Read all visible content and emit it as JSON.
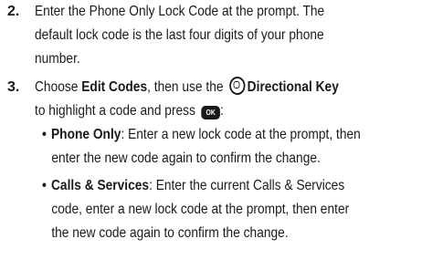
{
  "steps": [
    {
      "number": "2.",
      "lines": [
        "Enter the Phone Only Lock Code at the prompt. The",
        "default lock code is the last four digits of your phone",
        "number."
      ]
    },
    {
      "number": "3.",
      "prefix": "Choose ",
      "edit_codes": "Edit Codes",
      "mid": ", then use the ",
      "directional_key": "Directional Key",
      "line2": "to highlight a code and press ",
      "ok_label": "OK",
      "colon": ":"
    }
  ],
  "bullets": [
    {
      "title": "Phone Only",
      "line1": ": Enter a new lock code at the prompt, then",
      "line2": "enter the new code again to confirm the change."
    },
    {
      "title": "Calls & Services",
      "line1": ": Enter the current Calls & Services",
      "line2": "code, enter a new lock code at the prompt, then enter",
      "line3": "the new code again to confirm the change."
    }
  ],
  "bullet_char": "•"
}
